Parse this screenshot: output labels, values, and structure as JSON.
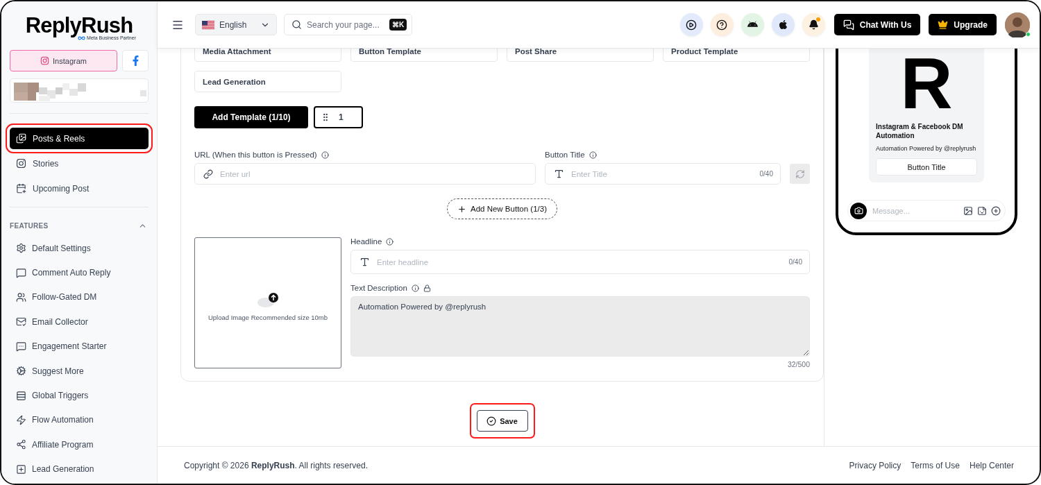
{
  "logo": {
    "name": "ReplyRush",
    "tagline": "Meta Business Partner"
  },
  "platforms": [
    {
      "kind": "instagram",
      "label": "Instagram",
      "selected": true
    },
    {
      "kind": "facebook",
      "selected": false
    }
  ],
  "nav": [
    {
      "label": "Posts & Reels",
      "selected": true,
      "highlighted": true
    },
    {
      "label": "Stories",
      "selected": false,
      "highlighted": false
    },
    {
      "label": "Upcoming Post",
      "selected": false,
      "highlighted": false
    }
  ],
  "features": {
    "title": "FEATURES",
    "expanded": true,
    "items": [
      "Default Settings",
      "Comment Auto Reply",
      "Follow-Gated DM",
      "Email Collector",
      "Engagement Starter",
      "Suggest More",
      "Global Triggers",
      "Flow Automation",
      "Affiliate Program",
      "Lead Generation"
    ]
  },
  "header": {
    "language": "English",
    "search_placeholder": "Search your page...",
    "shortcut": "⌘K",
    "chat_button": "Chat With Us",
    "upgrade_button": "Upgrade",
    "online": true,
    "notification": true
  },
  "templates": [
    "Media Attachment",
    "Button Template",
    "Post Share",
    "Product Template",
    "Lead Generation"
  ],
  "add_template": "Add Template (1/10)",
  "template_tabs": [
    {
      "label": "1",
      "selected": true
    }
  ],
  "url_field": {
    "label": "URL (When this button is Pressed)",
    "placeholder": "Enter url"
  },
  "title_field": {
    "label": "Button Title",
    "placeholder": "Enter Title",
    "counter": "0/40"
  },
  "add_button": "Add New Button (1/3)",
  "upload": {
    "text": "Upload Image Recommended size 10mb"
  },
  "headline": {
    "label": "Headline",
    "placeholder": "Enter headline",
    "counter": "0/40"
  },
  "description": {
    "label": "Text Description",
    "value": "Automation Powered by @replyrush",
    "counter": "32/500",
    "disabled": true
  },
  "save": {
    "label": "Save",
    "highlighted": true
  },
  "preview": {
    "image_letter": "R",
    "title": "Instagram & Facebook DM Automation",
    "text": "Automation Powered by @replyrush",
    "button": "Button Title",
    "message_placeholder": "Message..."
  },
  "footer": {
    "copyright": "Copyright © 2026 **ReplyRush**. All rights reserved.",
    "links": [
      "Privacy Policy",
      "Terms of Use",
      "Help Center"
    ]
  }
}
